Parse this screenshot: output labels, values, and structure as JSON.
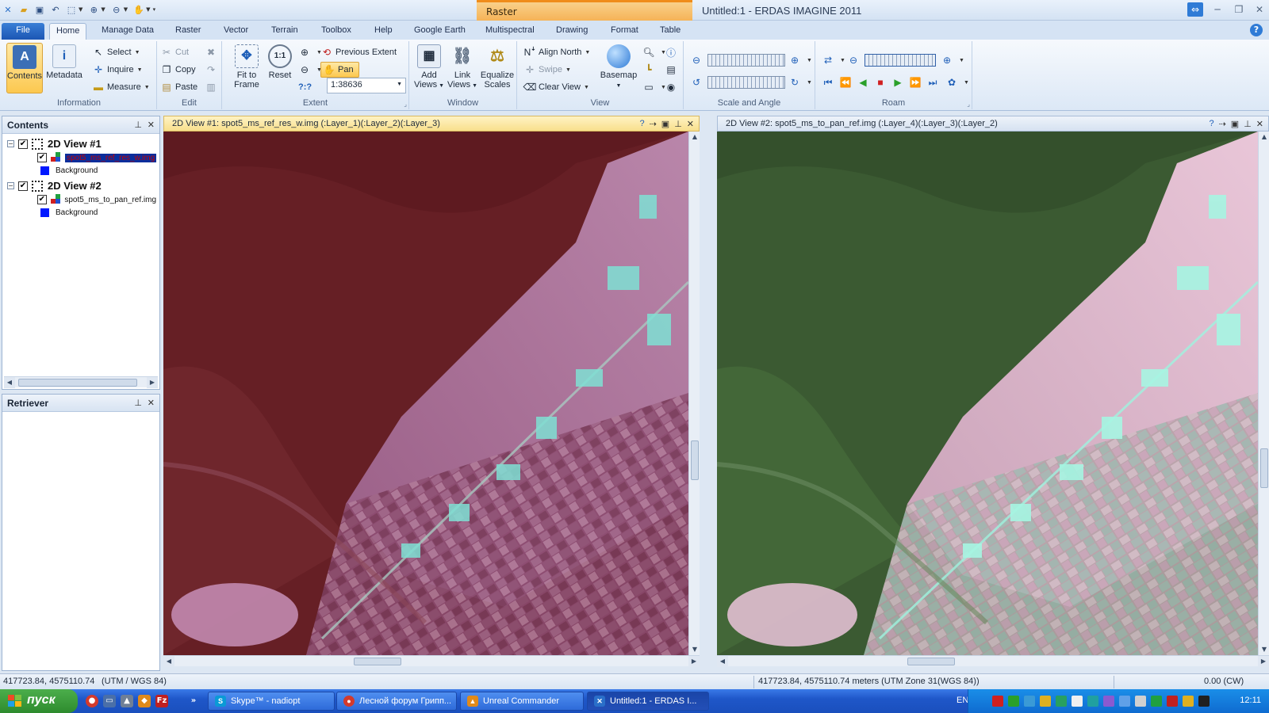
{
  "window": {
    "title": "Untitled:1 - ERDAS IMAGINE 2011",
    "context_tab_group": "Raster"
  },
  "ribbon_tabs": [
    "File",
    "Home",
    "Manage Data",
    "Raster",
    "Vector",
    "Terrain",
    "Toolbox",
    "Help",
    "Google Earth",
    "Multispectral",
    "Drawing",
    "Format",
    "Table"
  ],
  "active_tab": "Home",
  "ribbon": {
    "information": {
      "label": "Information",
      "contents": "Contents",
      "metadata": "Metadata",
      "select": "Select",
      "inquire": "Inquire",
      "measure": "Measure"
    },
    "edit": {
      "label": "Edit",
      "cut": "Cut",
      "copy": "Copy",
      "paste": "Paste"
    },
    "extent": {
      "label": "Extent",
      "fit_to_frame_1": "Fit to",
      "fit_to_frame_2": "Frame",
      "reset": "Reset",
      "previous_extent": "Previous Extent",
      "pan": "Pan",
      "scale_value": "1:38636",
      "unknown_scale": "?:?"
    },
    "window_group": {
      "label": "Window",
      "add_views_1": "Add",
      "add_views_2": "Views",
      "link_views_1": "Link",
      "link_views_2": "Views",
      "equalize_1": "Equalize",
      "equalize_2": "Scales"
    },
    "view_group": {
      "label": "View",
      "align_north": "Align North",
      "swipe": "Swipe",
      "clear_view": "Clear View",
      "basemap": "Basemap"
    },
    "scale_angle": {
      "label": "Scale and Angle"
    },
    "roam": {
      "label": "Roam"
    }
  },
  "contents_panel": {
    "title": "Contents",
    "views": [
      {
        "name": "2D View #1",
        "layer": "spot5_ms_ref_res_w.img",
        "background": "Background",
        "layer_selected": true
      },
      {
        "name": "2D View #2",
        "layer": "spot5_ms_to_pan_ref.img",
        "background": "Background",
        "layer_selected": false
      }
    ]
  },
  "retriever_panel": {
    "title": "Retriever"
  },
  "view1": {
    "title": "2D View #1: spot5_ms_ref_res_w.img (:Layer_1)(:Layer_2)(:Layer_3)",
    "palette": {
      "base": "#6a1e22",
      "urban": "#c98ab8",
      "bright": "#7fe0d4"
    }
  },
  "view2": {
    "title": "2D View #2: spot5_ms_to_pan_ref.img (:Layer_4)(:Layer_3)(:Layer_2)",
    "palette": {
      "base": "#35552e",
      "urban": "#e3b6cf",
      "bright": "#9ff2de"
    }
  },
  "statusbar": {
    "coords_left": "417723.84, 4575110.74",
    "crs_left": "(UTM / WGS 84)",
    "coords_right": "417723.84, 4575110.74 meters (UTM Zone 31(WGS 84))",
    "rotation": "0.00 (CW)"
  },
  "taskbar": {
    "start": "пуск",
    "tasks": [
      {
        "label": "Skype™ - nadiopt",
        "icon": "skype-icon",
        "color": "#0a9ad6",
        "glyph": "S"
      },
      {
        "label": "Лесной форум Грипп...",
        "icon": "chrome-icon",
        "color": "#d33a2c",
        "glyph": "●"
      },
      {
        "label": "Unreal Commander",
        "icon": "unreal-commander-icon",
        "color": "#e08a1a",
        "glyph": "▲"
      },
      {
        "label": "Untitled:1 - ERDAS I...",
        "icon": "erdas-icon",
        "color": "#2a6fc9",
        "glyph": "✕",
        "active": true
      }
    ],
    "language": "EN",
    "clock": "12:11"
  }
}
